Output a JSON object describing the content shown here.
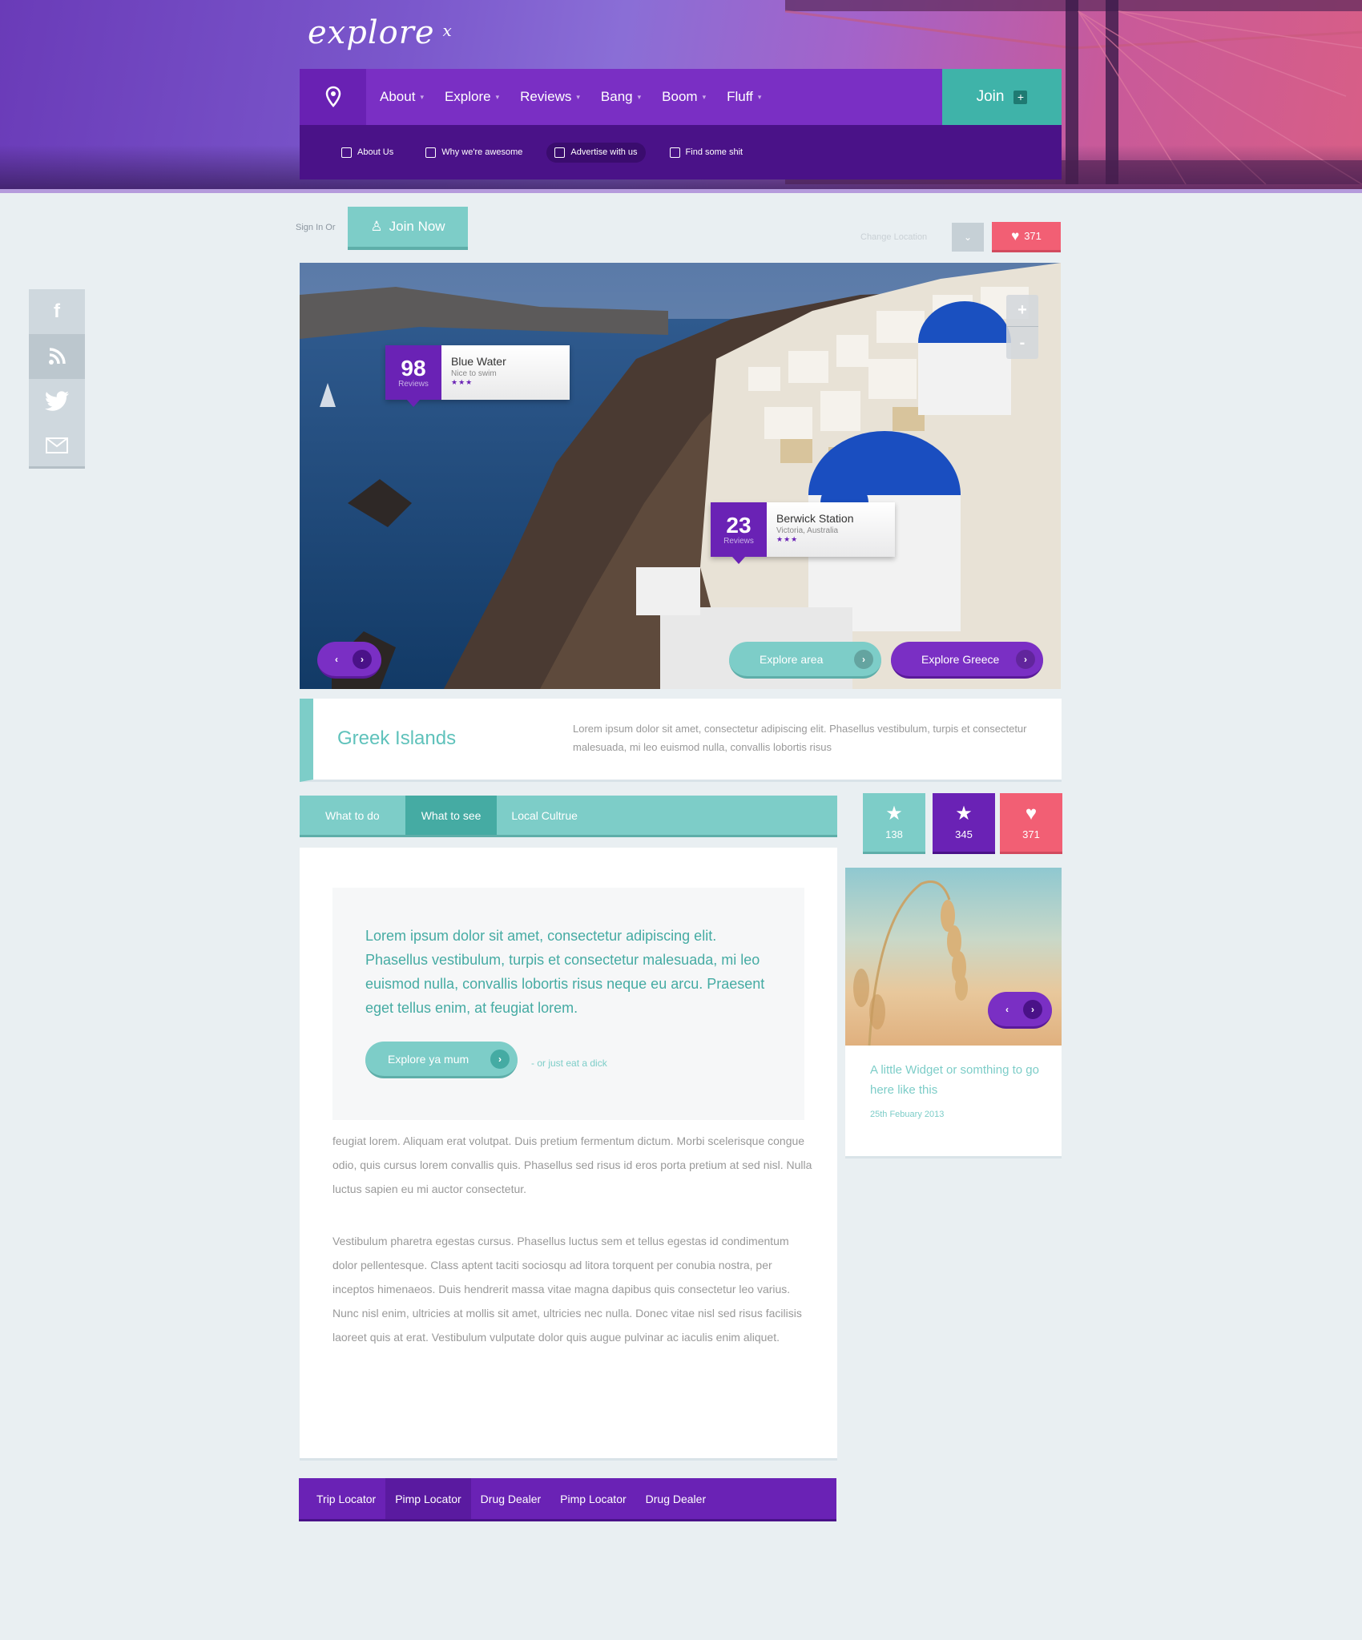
{
  "header": {
    "logo": "explore",
    "logo_suffix": "x",
    "nav": [
      {
        "label": "About",
        "caret": "▾"
      },
      {
        "label": "Explore",
        "caret": "▾"
      },
      {
        "label": "Reviews",
        "caret": "▾"
      },
      {
        "label": "Bang",
        "caret": "▾"
      },
      {
        "label": "Boom",
        "caret": "▾"
      },
      {
        "label": "Fluff",
        "caret": "▾"
      }
    ],
    "join_label": "Join",
    "join_plus": "+",
    "subnav": [
      {
        "label": "About Us",
        "icon": "facebook-square-icon"
      },
      {
        "label": "Why we're awesome",
        "icon": "download-icon"
      },
      {
        "label": "Advertise with us",
        "icon": "book-icon"
      },
      {
        "label": "Find some shit",
        "icon": "map-pin-icon"
      }
    ]
  },
  "account": {
    "signin_text": "Sign In Or",
    "join_now": "Join Now",
    "change_location": "Change Location",
    "likes": "371"
  },
  "social": [
    "f",
    "rss",
    "twitter",
    "email"
  ],
  "slider": {
    "zoom_in": "+",
    "zoom_out": "-",
    "pins": [
      {
        "count": "98",
        "count_label": "Reviews",
        "title": "Blue Water",
        "subtitle": "Nice to swim",
        "stars": "★★★"
      },
      {
        "count": "23",
        "count_label": "Reviews",
        "title": "Berwick Station",
        "subtitle": "Victoria, Australia",
        "stars": "★★★"
      }
    ],
    "prev": "‹",
    "next": "›",
    "explore_area": "Explore area",
    "explore_greece": "Explore Greece"
  },
  "intro": {
    "title": "Greek Islands",
    "text": "Lorem ipsum dolor sit amet, consectetur adipiscing elit. Phasellus vestibulum, turpis et consectetur malesuada, mi leo euismod nulla, convallis lobortis risus"
  },
  "tabs": [
    "What to do",
    "What to see",
    "Local Cultrue"
  ],
  "stats": [
    {
      "icon": "star-icon",
      "glyph": "★",
      "value": "138"
    },
    {
      "icon": "star-icon",
      "glyph": "★",
      "value": "345"
    },
    {
      "icon": "heart-icon",
      "glyph": "♥",
      "value": "371"
    }
  ],
  "article": {
    "quote": "Lorem ipsum dolor sit amet, consectetur adipiscing elit. Phasellus vestibulum, turpis et consectetur malesuada, mi leo euismod nulla, convallis lobortis risus neque eu arcu. Praesent eget tellus enim, at feugiat lorem.",
    "cta": "Explore ya mum",
    "cta_alt": "-   or just eat a dick",
    "para1": "feugiat lorem. Aliquam erat volutpat. Duis pretium fermentum dictum. Morbi scelerisque congue odio, quis cursus lorem convallis quis. Phasellus sed risus id eros porta pretium at sed nisl. Nulla luctus sapien eu mi auctor consectetur.",
    "para2": "Vestibulum pharetra egestas cursus. Phasellus luctus sem et tellus egestas id condimentum dolor pellentesque. Class aptent taciti sociosqu ad litora torquent per conubia nostra, per inceptos himenaeos. Duis hendrerit massa vitae magna dapibus quis consectetur leo varius. Nunc nisl enim, ultricies at mollis sit amet, ultricies nec nulla. Donec vitae nisl sed risus facilisis laoreet quis at erat. Vestibulum vulputate dolor quis augue pulvinar ac iaculis enim aliquet."
  },
  "widget": {
    "text": "A little Widget or somthing to go here like this",
    "date": "25th Febuary 2013"
  },
  "footer_nav": [
    "Trip Locator",
    "Pimp Locator",
    "Drug Dealer",
    "Pimp Locator",
    "Drug Dealer"
  ]
}
